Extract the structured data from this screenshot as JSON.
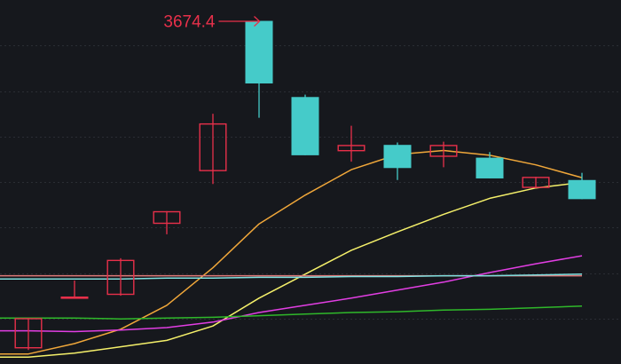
{
  "chart_data": {
    "type": "candlestick",
    "grid": true,
    "ylim": [
      3250,
      3695
    ],
    "annotations": [
      {
        "text": "3674.4",
        "candle_index": 5,
        "price": 3674.4
      }
    ],
    "colors": {
      "background": "#16181d",
      "up": "#e8304a",
      "down": "#45cbc9",
      "grid": "#2a2d34",
      "annotation": "#e8304a"
    },
    "candles": [
      {
        "open": 3264,
        "close": 3302,
        "high": 3302,
        "low": 3262
      },
      {
        "open": 3329,
        "close": 3329,
        "high": 3349,
        "low": 3327
      },
      {
        "open": 3331,
        "close": 3375,
        "high": 3377,
        "low": 3330
      },
      {
        "open": 3420,
        "close": 3436,
        "high": 3436,
        "low": 3407
      },
      {
        "open": 3486,
        "close": 3546,
        "high": 3558,
        "low": 3470
      },
      {
        "open": 3674.4,
        "close": 3596,
        "high": 3674.4,
        "low": 3553
      },
      {
        "open": 3579,
        "close": 3506,
        "high": 3582,
        "low": 3506
      },
      {
        "open": 3511,
        "close": 3519,
        "high": 3543,
        "low": 3498
      },
      {
        "open": 3519,
        "close": 3490,
        "high": 3522,
        "low": 3475
      },
      {
        "open": 3504,
        "close": 3519,
        "high": 3523,
        "low": 3491
      },
      {
        "open": 3503,
        "close": 3477,
        "high": 3510,
        "low": 3477
      },
      {
        "open": 3465,
        "close": 3479,
        "high": 3479,
        "low": 3465
      },
      {
        "open": 3475,
        "close": 3451,
        "high": 3484,
        "low": 3451
      }
    ],
    "series": [
      {
        "color": "#f0a73a",
        "values": [
          3257,
          3270,
          3288,
          3318,
          3365,
          3420,
          3456,
          3488,
          3507,
          3512,
          3506,
          3494,
          3478
        ]
      },
      {
        "color": "#f5f06a",
        "values": [
          3253,
          3258,
          3266,
          3274,
          3292,
          3327,
          3357,
          3387,
          3410,
          3432,
          3452,
          3465,
          3472
        ]
      },
      {
        "color": "#e23ee3",
        "values": [
          3286,
          3285,
          3287,
          3290,
          3297,
          3309,
          3318,
          3327,
          3337,
          3347,
          3359,
          3370,
          3380
        ]
      },
      {
        "color": "#2fb82a",
        "values": [
          3302,
          3302,
          3301,
          3302,
          3303,
          3305,
          3307,
          3309,
          3310,
          3312,
          3313,
          3315,
          3317
        ]
      },
      {
        "color": "#e07a7a",
        "values": [
          3355,
          3355,
          3355,
          3355,
          3355,
          3355,
          3355,
          3355,
          3355,
          3355,
          3355,
          3355,
          3355
        ]
      },
      {
        "color": "#7fe0e0",
        "values": [
          3351,
          3351,
          3351,
          3352,
          3352,
          3353,
          3353,
          3354,
          3354,
          3355,
          3355,
          3356,
          3357
        ]
      }
    ]
  }
}
